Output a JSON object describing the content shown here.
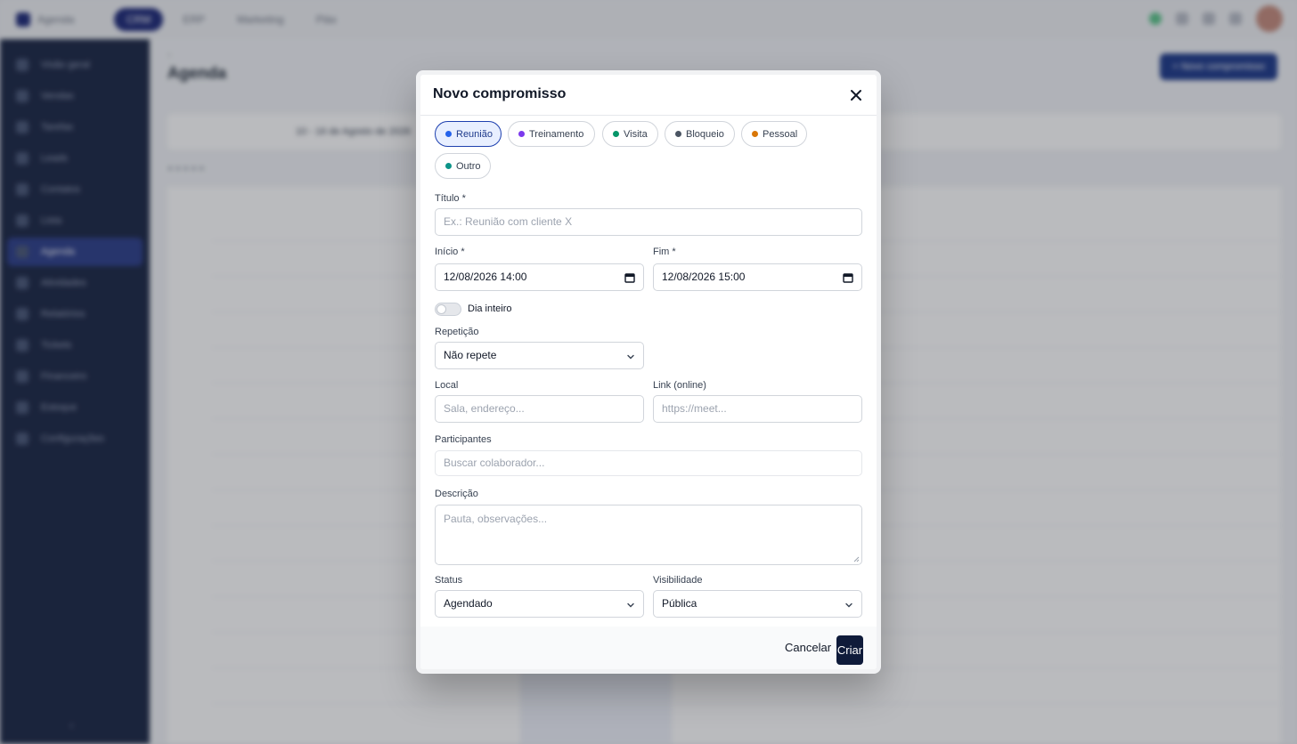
{
  "background": {
    "brand": "Agenda",
    "nav_tabs": [
      "CRM",
      "ERP",
      "Marketing",
      "Pláx"
    ],
    "sidebar": [
      "Visão geral",
      "Vendas",
      "Tarefas",
      "Leads",
      "Contatos",
      "Lista",
      "Agenda",
      "Atividades",
      "Relatórios",
      "Tickets",
      "Financeiro",
      "Estoque",
      "Configurações"
    ],
    "page_title": "Agenda",
    "new_button": "+ Novo compromisso",
    "range_label": "10 - 16 de Agosto de 2026"
  },
  "modal": {
    "title": "Novo compromisso",
    "types": [
      {
        "label": "Reunião",
        "color": "#2563eb",
        "active": true
      },
      {
        "label": "Treinamento",
        "color": "#7c3aed",
        "active": false
      },
      {
        "label": "Visita",
        "color": "#059669",
        "active": false
      },
      {
        "label": "Bloqueio",
        "color": "#4b5563",
        "active": false
      },
      {
        "label": "Pessoal",
        "color": "#d97706",
        "active": false
      },
      {
        "label": "Outro",
        "color": "#0d9488",
        "active": false
      }
    ],
    "title_label": "Título *",
    "title_placeholder": "Ex.: Reunião com cliente X",
    "start_label": "Início *",
    "start_value": "12/08/2026 14:00",
    "end_label": "Fim *",
    "end_value": "12/08/2026 15:00",
    "all_day_label": "Dia inteiro",
    "all_day": false,
    "repeat_label": "Repetição",
    "repeat_value": "Não repete",
    "location_label": "Local",
    "location_placeholder": "Sala, endereço...",
    "link_label": "Link (online)",
    "link_placeholder": "https://meet...",
    "participants_label": "Participantes",
    "participants_placeholder": "Buscar colaborador...",
    "description_label": "Descrição",
    "description_placeholder": "Pauta, observações...",
    "status_label": "Status",
    "status_value": "Agendado",
    "visibility_label": "Visibilidade",
    "visibility_value": "Pública",
    "cancel_label": "Cancelar",
    "create_label": "Criar"
  }
}
